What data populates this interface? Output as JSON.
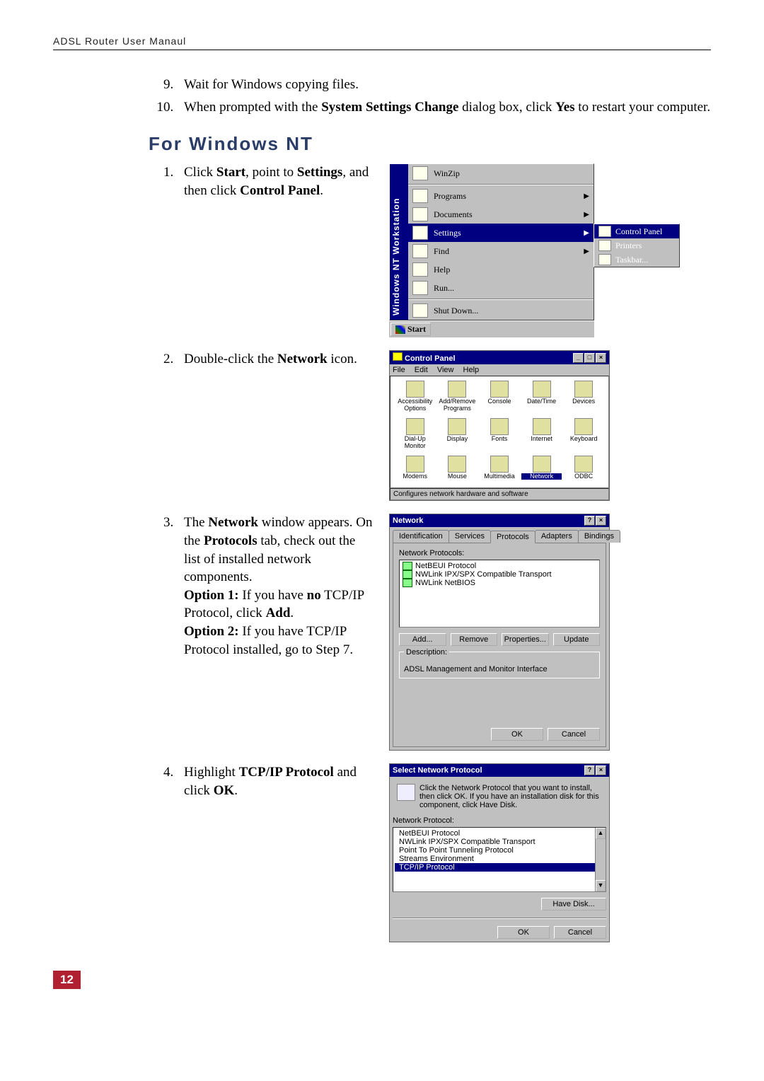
{
  "header": {
    "text": "ADSL Router User Manaul"
  },
  "steps_top": {
    "s9": "Wait for Windows copying files.",
    "s10_a": "When prompted with the ",
    "s10_b": "System Settings Change",
    "s10_c": " dialog box, click ",
    "s10_d": "Yes",
    "s10_e": " to restart your computer."
  },
  "section_heading": "For Windows NT",
  "nt": {
    "s1": {
      "a": "Click ",
      "b": "Start",
      "c": ", point to ",
      "d": "Settings",
      "e": ", and then click ",
      "f": "Control Panel",
      "g": "."
    },
    "s2": {
      "a": "Double-click the ",
      "b": "Network",
      "c": " icon."
    },
    "s3": {
      "a": "The ",
      "b": "Network",
      "c": " window appears. On the ",
      "d": "Protocols",
      "e": " tab, check out the list of installed network components.",
      "o1a": "Option 1:",
      "o1b": " If you have ",
      "o1c": "no",
      "o1d": " TCP/IP Protocol, click ",
      "o1e": "Add",
      "o1f": ".",
      "o2a": "Option 2:",
      "o2b": " If you have TCP/IP Protocol installed, go to Step 7."
    },
    "s4": {
      "a": "Highlight ",
      "b": "TCP/IP Protocol",
      "c": " and click ",
      "d": "OK",
      "e": "."
    }
  },
  "startmenu": {
    "sidebar": "Windows NT Workstation",
    "items": [
      {
        "label": "WinZip"
      },
      {
        "label": "Programs",
        "arrow": true
      },
      {
        "label": "Documents",
        "arrow": true
      },
      {
        "label": "Settings",
        "arrow": true,
        "selected": true
      },
      {
        "label": "Find",
        "arrow": true
      },
      {
        "label": "Help"
      },
      {
        "label": "Run..."
      },
      {
        "label": "Shut Down..."
      }
    ],
    "submenu": {
      "items": [
        {
          "label": "Control Panel",
          "selected": true
        },
        {
          "label": "Printers"
        },
        {
          "label": "Taskbar..."
        }
      ]
    },
    "start_label": "Start"
  },
  "control_panel": {
    "title": "Control Panel",
    "menus": [
      "File",
      "Edit",
      "View",
      "Help"
    ],
    "icons": [
      "Accessibility Options",
      "Add/Remove Programs",
      "Console",
      "Date/Time",
      "Devices",
      "Dial-Up Monitor",
      "Display",
      "Fonts",
      "Internet",
      "Keyboard",
      "Modems",
      "Mouse",
      "Multimedia",
      "Network",
      "ODBC"
    ],
    "status": "Configures network hardware and software"
  },
  "network_dialog": {
    "title": "Network",
    "tabs": [
      "Identification",
      "Services",
      "Protocols",
      "Adapters",
      "Bindings"
    ],
    "label_protocols": "Network Protocols:",
    "protocols": [
      "NetBEUI Protocol",
      "NWLink IPX/SPX Compatible Transport",
      "NWLink NetBIOS"
    ],
    "buttons": {
      "add": "Add...",
      "remove": "Remove",
      "properties": "Properties...",
      "update": "Update"
    },
    "desc_label": "Description:",
    "desc_text": "ADSL Management and Monitor Interface",
    "ok": "OK",
    "cancel": "Cancel"
  },
  "select_protocol": {
    "title": "Select Network Protocol",
    "help": "Click the Network Protocol that you want to install, then click OK. If you have an installation disk for this component, click Have Disk.",
    "label": "Network Protocol:",
    "items": [
      {
        "label": "NetBEUI Protocol"
      },
      {
        "label": "NWLink IPX/SPX Compatible Transport"
      },
      {
        "label": "Point To Point Tunneling Protocol"
      },
      {
        "label": "Streams Environment"
      },
      {
        "label": "TCP/IP Protocol",
        "selected": true
      }
    ],
    "have_disk": "Have Disk...",
    "ok": "OK",
    "cancel": "Cancel"
  },
  "page_number": "12"
}
